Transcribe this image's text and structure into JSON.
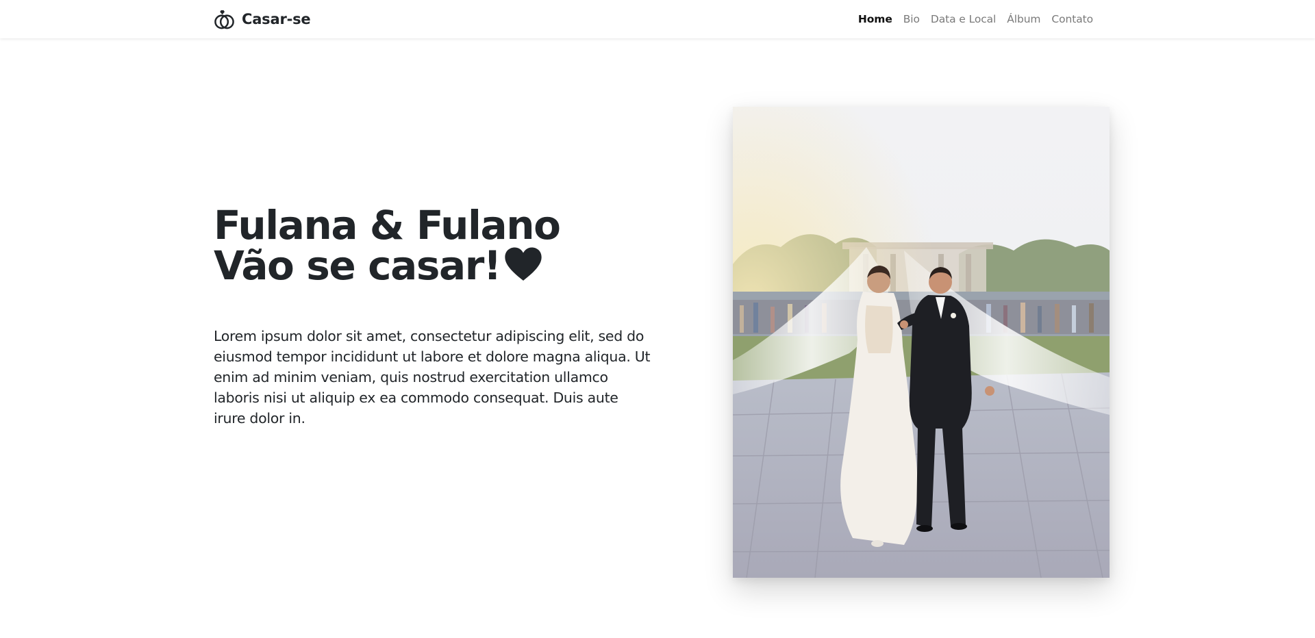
{
  "brand": {
    "name": "Casar-se",
    "icon": "wedding-rings-icon"
  },
  "nav": {
    "items": [
      {
        "label": "Home",
        "active": true
      },
      {
        "label": "Bio",
        "active": false
      },
      {
        "label": "Data e Local",
        "active": false
      },
      {
        "label": "Álbum",
        "active": false
      },
      {
        "label": "Contato",
        "active": false
      }
    ]
  },
  "hero": {
    "title_line1": "Fulana & Fulano",
    "title_line2": "Vão se casar!",
    "title_icon": "heart-icon",
    "description": "Lorem ipsum dolor sit amet, consectetur adipiscing elit, sed do eiusmod tempor incididunt ut labore et dolore magna aliqua. Ut enim ad minim veniam, quis nostrud exercitation ullamco laboris nisi ut aliquip ex ea commodo consequat. Duis aute irure dolor in."
  },
  "photo": {
    "subject": "bride and groom walking"
  },
  "colors": {
    "text": "#212529",
    "nav_inactive": "#7a7a7a",
    "nav_active": "#111111",
    "background": "#ffffff"
  }
}
